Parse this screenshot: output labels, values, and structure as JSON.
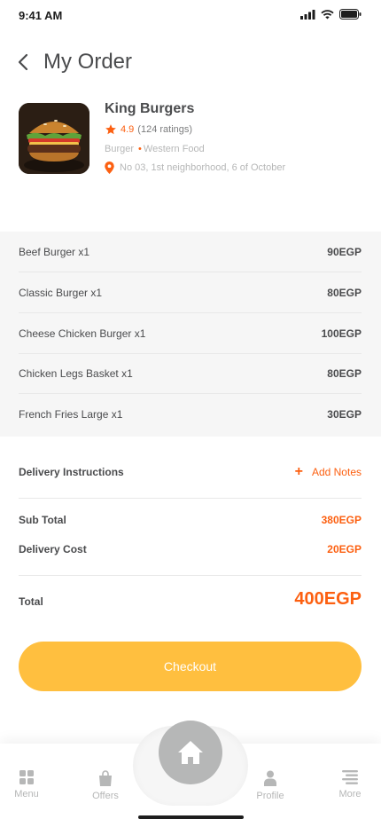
{
  "status_bar": {
    "time": "9:41 AM"
  },
  "header": {
    "title": "My Order"
  },
  "restaurant": {
    "name": "King Burgers",
    "rating": "4.9",
    "ratings_count": "(124 ratings)",
    "category": "Burger",
    "cuisine": "Western Food",
    "address": "No 03, 1st neighborhood, 6 of October"
  },
  "items": [
    {
      "name": "Beef Burger x1",
      "price": "90EGP"
    },
    {
      "name": "Classic Burger x1",
      "price": "80EGP"
    },
    {
      "name": "Cheese Chicken Burger x1",
      "price": "100EGP"
    },
    {
      "name": "Chicken Legs Basket x1",
      "price": "80EGP"
    },
    {
      "name": "French Fries Large x1",
      "price": "30EGP"
    }
  ],
  "delivery": {
    "label": "Delivery Instructions",
    "add_notes": "Add Notes"
  },
  "summary": {
    "subtotal_label": "Sub Total",
    "subtotal": "380EGP",
    "delivery_label": "Delivery Cost",
    "delivery": "20EGP",
    "total_label": "Total",
    "total": "400EGP"
  },
  "checkout": {
    "label": "Checkout"
  },
  "nav": {
    "menu": "Menu",
    "offers": "Offers",
    "profile": "Profile",
    "more": "More"
  },
  "colors": {
    "accent": "#fc6011",
    "button": "#ffbf3f",
    "inactive": "#b6b7b7",
    "text": "#4a4b4d"
  },
  "icons": [
    "back-icon",
    "star-icon",
    "location-pin-icon",
    "plus-icon",
    "menu-grid-icon",
    "shopping-bag-icon",
    "home-icon",
    "user-icon",
    "more-icon"
  ]
}
